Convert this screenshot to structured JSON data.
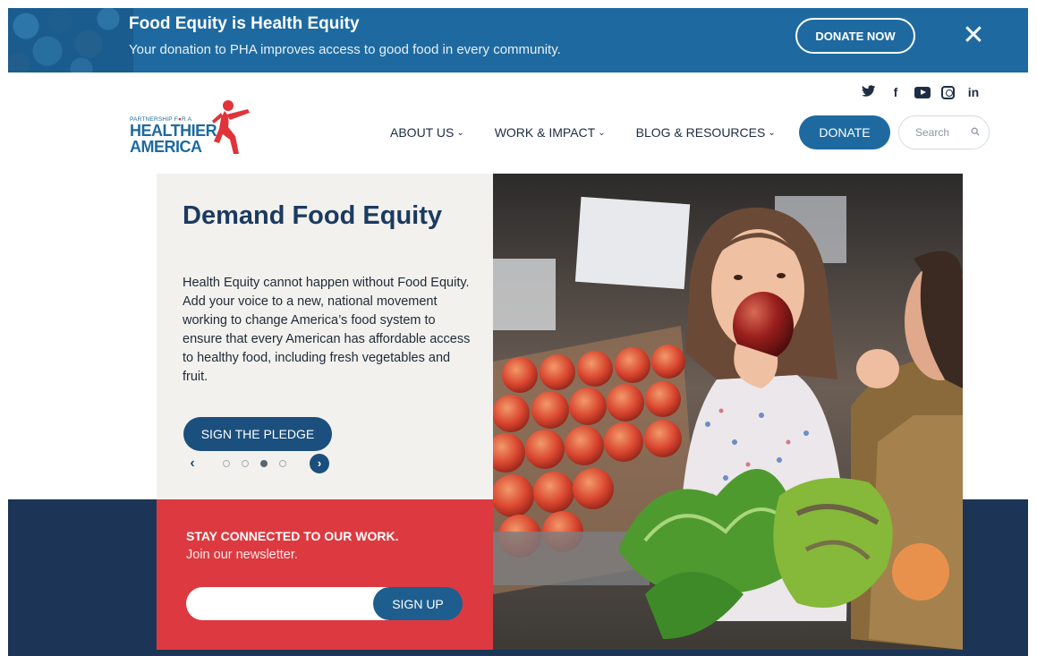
{
  "promo": {
    "title": "Food Equity is Health Equity",
    "subtitle": "Your donation to PHA improves access to good food in every community.",
    "donate_label": "DONATE NOW",
    "close_icon": "close-icon",
    "bg_color": "#1e6aa0"
  },
  "header": {
    "social": [
      "twitter-icon",
      "facebook-icon",
      "youtube-icon",
      "instagram-icon",
      "linkedin-icon"
    ],
    "logo": {
      "small_text_a": "PARTNERSHIP F",
      "small_text_b": "R A",
      "line1": "HEALTHIER",
      "line2": "AMERICA"
    },
    "nav": [
      {
        "label": "ABOUT US"
      },
      {
        "label": "WORK & IMPACT"
      },
      {
        "label": "BLOG & RESOURCES"
      }
    ],
    "donate_label": "DONATE",
    "search_placeholder": "Search"
  },
  "hero": {
    "title": "Demand Food Equity",
    "body": "Health Equity cannot happen without Food Equity. Add your voice to a new, national movement working to change America’s food system to ensure that every American has affordable access to healthy food, including fresh vegetables and fruit.",
    "cta_label": "SIGN THE PLEDGE",
    "carousel": {
      "total_slides": 4,
      "active_slide": 3
    },
    "image_alt": "Child biting a red apple next to a smiling woman holding leafy greens in a produce market"
  },
  "newsletter": {
    "heading": "STAY CONNECTED TO OUR WORK.",
    "subheading": "Join our newsletter.",
    "signup_label": "SIGN UP"
  },
  "colors": {
    "brand_blue": "#1e6aa0",
    "navy": "#1c3557",
    "accent_red": "#dc3a40",
    "title_navy": "#1b3a5f"
  }
}
